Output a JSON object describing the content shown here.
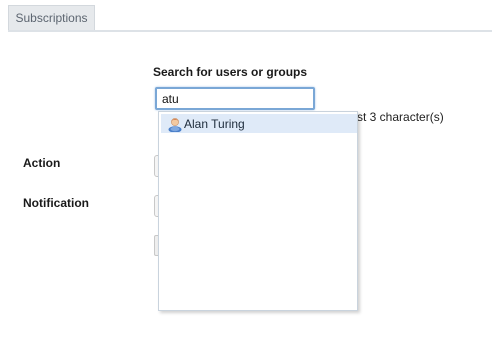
{
  "tabs": [
    {
      "label": "Subscriptions",
      "active": true
    }
  ],
  "search": {
    "label": "Search for users or groups",
    "value": "atu",
    "hint": "st 3 character(s)"
  },
  "form": {
    "action_label": "Action",
    "notification_label": "Notification"
  },
  "autocomplete": {
    "items": [
      {
        "label": "Alan Turing",
        "icon": "user-icon",
        "highlighted": true
      }
    ]
  },
  "colors": {
    "tab_background": "#e6e9ec",
    "input_focus_border": "#7aa7d6",
    "suggestion_highlight": "#dfeaf8"
  }
}
